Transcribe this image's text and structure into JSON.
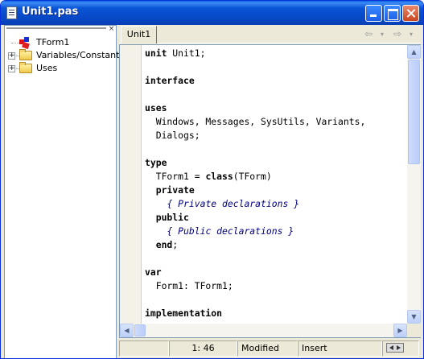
{
  "window": {
    "title": "Unit1.pas"
  },
  "explorer": {
    "close_glyph": "×",
    "items": [
      {
        "label": "TForm1",
        "icon": "form-icon",
        "expandable": false
      },
      {
        "label": "Variables/Constants",
        "icon": "folder-icon",
        "expandable": true,
        "expander": "+"
      },
      {
        "label": "Uses",
        "icon": "folder-icon",
        "expandable": true,
        "expander": "+"
      }
    ]
  },
  "editor": {
    "tabs": [
      {
        "label": "Unit1",
        "active": true
      }
    ],
    "nav": {
      "back": "⇦",
      "back_drop": "▾",
      "forward": "⇨",
      "forward_drop": "▾"
    },
    "code_lines": [
      [
        {
          "t": "unit",
          "s": "kw"
        },
        {
          "t": " Unit1;"
        }
      ],
      [
        {
          "t": ""
        }
      ],
      [
        {
          "t": "interface",
          "s": "kw"
        }
      ],
      [
        {
          "t": ""
        }
      ],
      [
        {
          "t": "uses",
          "s": "kw"
        }
      ],
      [
        {
          "t": "  Windows, Messages, SysUtils, Variants,"
        }
      ],
      [
        {
          "t": "  Dialogs;"
        }
      ],
      [
        {
          "t": ""
        }
      ],
      [
        {
          "t": "type",
          "s": "kw"
        }
      ],
      [
        {
          "t": "  TForm1 = "
        },
        {
          "t": "class",
          "s": "kw"
        },
        {
          "t": "(TForm)"
        }
      ],
      [
        {
          "t": "  "
        },
        {
          "t": "private",
          "s": "kw"
        }
      ],
      [
        {
          "t": "    "
        },
        {
          "t": "{ Private declarations }",
          "s": "cm"
        }
      ],
      [
        {
          "t": "  "
        },
        {
          "t": "public",
          "s": "kw"
        }
      ],
      [
        {
          "t": "    "
        },
        {
          "t": "{ Public declarations }",
          "s": "cm"
        }
      ],
      [
        {
          "t": "  "
        },
        {
          "t": "end",
          "s": "kw"
        },
        {
          "t": ";"
        }
      ],
      [
        {
          "t": ""
        }
      ],
      [
        {
          "t": "var",
          "s": "kw"
        }
      ],
      [
        {
          "t": "  Form1: TForm1;"
        }
      ],
      [
        {
          "t": ""
        }
      ],
      [
        {
          "t": "implementation",
          "s": "kw"
        }
      ]
    ]
  },
  "scrollbars": {
    "up": "▲",
    "down": "▼",
    "left": "◀",
    "right": "▶"
  },
  "statusbar": {
    "position": "1:  46",
    "modified": "Modified",
    "mode": "Insert"
  }
}
